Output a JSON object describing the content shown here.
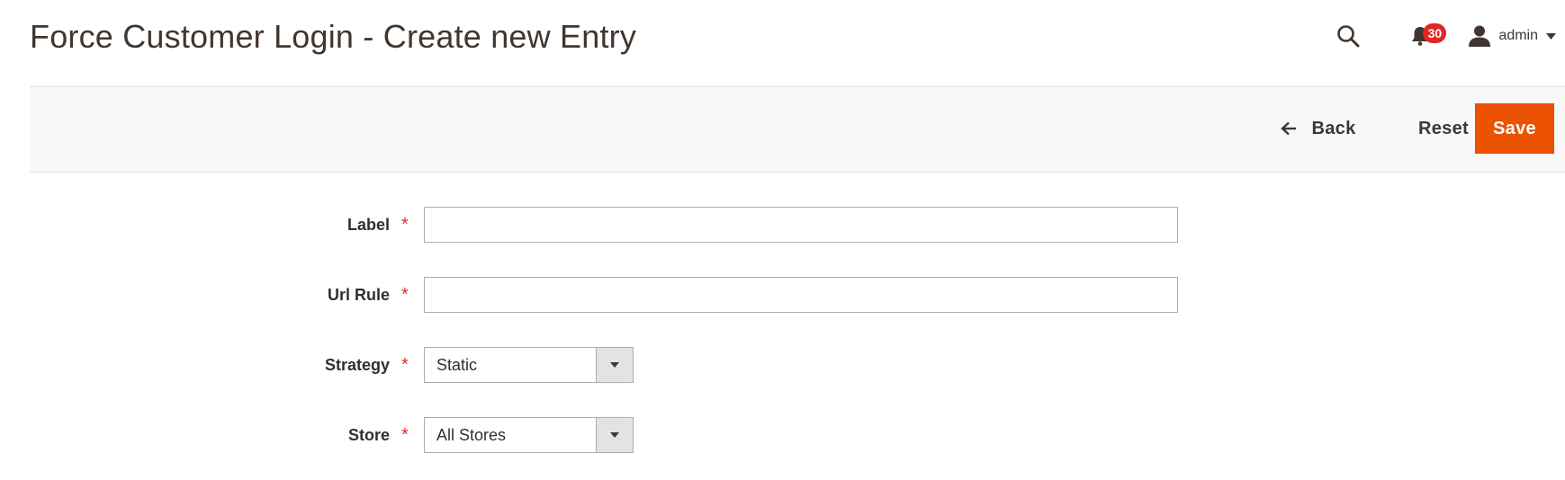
{
  "header": {
    "title": "Force Customer Login - Create new Entry",
    "notifications_count": "30",
    "user_name": "admin"
  },
  "actions": {
    "back_label": "Back",
    "reset_label": "Reset",
    "save_label": "Save"
  },
  "form": {
    "label": {
      "label": "Label",
      "value": ""
    },
    "url_rule": {
      "label": "Url Rule",
      "value": ""
    },
    "strategy": {
      "label": "Strategy",
      "selected": "Static"
    },
    "store": {
      "label": "Store",
      "selected": "All Stores"
    },
    "required_marker": "*"
  },
  "colors": {
    "accent": "#eb5202",
    "badge": "#e22626",
    "required": "#e02b27"
  },
  "icons": [
    "search-icon",
    "bell-icon",
    "user-icon",
    "caret-down-icon",
    "arrow-left-icon",
    "select-arrow-icon"
  ]
}
